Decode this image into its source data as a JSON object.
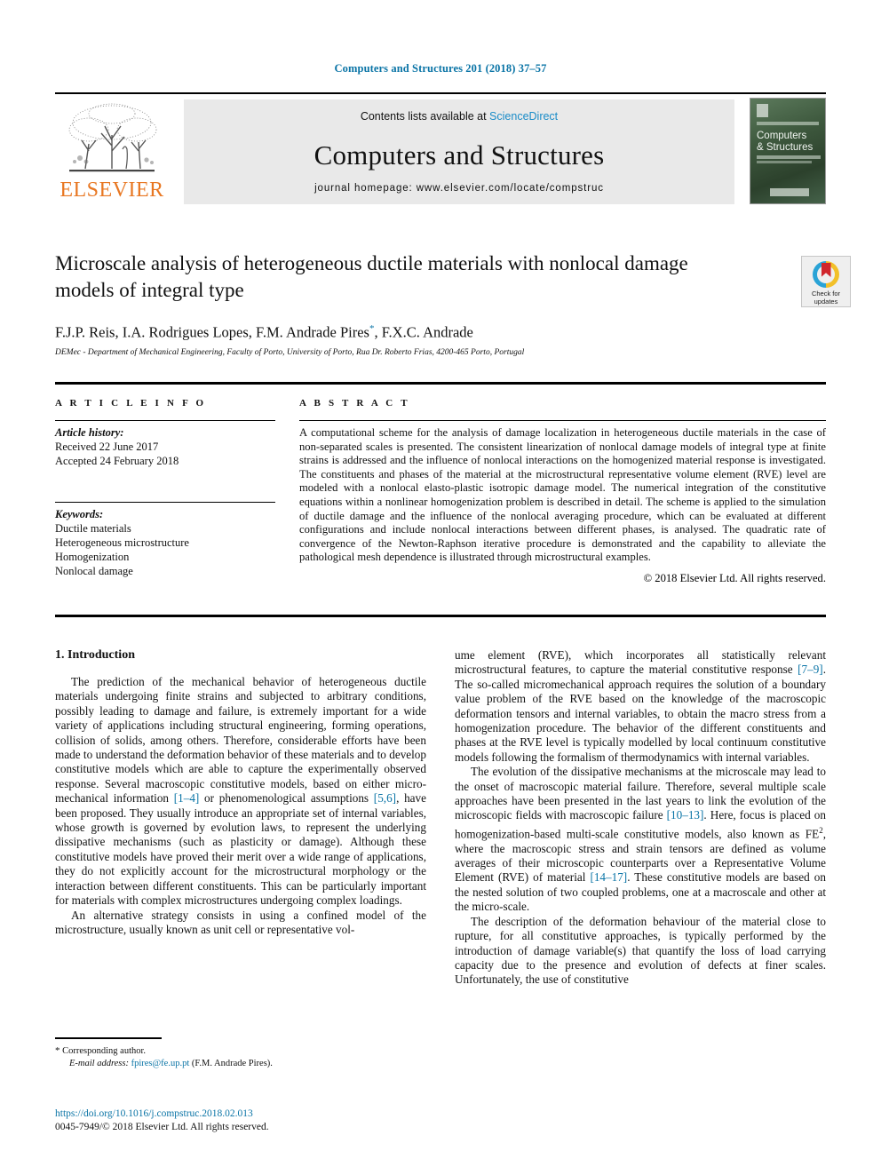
{
  "running_head": "Computers and Structures 201 (2018) 37–57",
  "masthead": {
    "contents_prefix": "Contents lists available at ",
    "sciencedirect": "ScienceDirect",
    "journal_name": "Computers and Structures",
    "homepage": "journal homepage: www.elsevier.com/locate/compstruc",
    "publisher_logo_text": "ELSEVIER",
    "publisher_logo_icon": "elsevier-tree-icon",
    "cover": {
      "line1": "Computers",
      "line2": "& Structures",
      "alt": "journal-cover-thumbnail"
    }
  },
  "article": {
    "title": "Microscale analysis of heterogeneous ductile materials with nonlocal damage models of integral type",
    "authors": "F.J.P. Reis, I.A. Rodrigues Lopes, F.M. Andrade Pires",
    "corresponding_marker": "*",
    "authors_tail": ", F.X.C. Andrade",
    "affiliation": "DEMec - Department of Mechanical Engineering, Faculty of Porto, University of Porto, Rua Dr. Roberto Frias, 4200-465 Porto, Portugal",
    "crossmark": {
      "line1": "Check for",
      "line2": "updates",
      "icon": "crossmark-badge-icon"
    }
  },
  "article_info": {
    "heading": "A R T I C L E   I N F O",
    "history_label": "Article history:",
    "history": [
      "Received 22 June 2017",
      "Accepted 24 February 2018"
    ],
    "keywords_label": "Keywords:",
    "keywords": [
      "Ductile materials",
      "Heterogeneous microstructure",
      "Homogenization",
      "Nonlocal damage"
    ]
  },
  "abstract": {
    "heading": "A B S T R A C T",
    "text": "A computational scheme for the analysis of damage localization in heterogeneous ductile materials in the case of non-separated scales is presented. The consistent linearization of nonlocal damage models of integral type at finite strains is addressed and the influence of nonlocal interactions on the homogenized material response is investigated. The constituents and phases of the material at the microstructural representative volume element (RVE) level are modeled with a nonlocal elasto-plastic isotropic damage model. The numerical integration of the constitutive equations within a nonlinear homogenization problem is described in detail. The scheme is applied to the simulation of ductile damage and the influence of the nonlocal averaging procedure, which can be evaluated at different configurations and include nonlocal interactions between different phases, is analysed. The quadratic rate of convergence of the Newton-Raphson iterative procedure is demonstrated and the capability to alleviate the pathological mesh dependence is illustrated through microstructural examples.",
    "copyright": "© 2018 Elsevier Ltd. All rights reserved."
  },
  "body": {
    "section_heading": "1. Introduction",
    "left_paragraph_1_a": "The prediction of the mechanical behavior of heterogeneous ductile materials undergoing finite strains and subjected to arbitrary conditions, possibly leading to damage and failure, is extremely important for a wide variety of applications including structural engineering, forming operations, collision of solids, among others. Therefore, considerable efforts have been made to understand the deformation behavior of these materials and to develop constitutive models which are able to capture the experimentally observed response. Several macroscopic constitutive models, based on either micro-mechanical information ",
    "ref_1_4": "[1–4]",
    "left_paragraph_1_b": " or phenomenological assumptions ",
    "ref_5_6": "[5,6]",
    "left_paragraph_1_c": ", have been proposed. They usually introduce an appropriate set of internal variables, whose growth is governed by evolution laws, to represent the underlying dissipative mechanisms (such as plasticity or damage). Although these constitutive models have proved their merit over a wide range of applications, they do not explicitly account for the microstructural morphology or the interaction between different constituents. This can be particularly important for materials with complex microstructures undergoing complex loadings.",
    "left_paragraph_2": "An alternative strategy consists in using a confined model of the microstructure, usually known as unit cell or representative vol-",
    "right_paragraph_1_a": "ume element (RVE), which incorporates all statistically relevant microstructural features, to capture the material constitutive response ",
    "ref_7_9": "[7–9]",
    "right_paragraph_1_b": ". The so-called micromechanical approach requires the solution of a boundary value problem of the RVE based on the knowledge of the macroscopic deformation tensors and internal variables, to obtain the macro stress from a homogenization procedure. The behavior of the different constituents and phases at the RVE level is typically modelled by local continuum constitutive models following the formalism of thermodynamics with internal variables.",
    "right_paragraph_2_a": "The evolution of the dissipative mechanisms at the microscale may lead to the onset of macroscopic material failure. Therefore, several multiple scale approaches have been presented in the last years to link the evolution of the microscopic fields with macroscopic failure ",
    "ref_10_13": "[10–13]",
    "right_paragraph_2_b": ". Here, focus is placed on homogenization-based multi-scale constitutive models, also known as FE",
    "fe_superscript": "2",
    "right_paragraph_2_c": ", where the macroscopic stress and strain tensors are defined as volume averages of their microscopic counterparts over a Representative Volume Element (RVE) of material ",
    "ref_14_17": "[14–17]",
    "right_paragraph_2_d": ". These constitutive models are based on the nested solution of two coupled problems, one at a macroscale and other at the micro-scale.",
    "right_paragraph_3": "The description of the deformation behaviour of the material close to rupture, for all constitutive approaches, is typically performed by the introduction of damage variable(s) that quantify the loss of load carrying capacity due to the presence and evolution of defects at finer scales. Unfortunately, the use of constitutive"
  },
  "footnotes": {
    "corresponding_star": "*",
    "corresponding_text": "Corresponding author.",
    "email_label": "E-mail address:",
    "email": "fpires@fe.up.pt",
    "email_owner": "(F.M. Andrade Pires)."
  },
  "footer": {
    "doi": "https://doi.org/10.1016/j.compstruc.2018.02.013",
    "issn_line": "0045-7949/© 2018 Elsevier Ltd. All rights reserved."
  },
  "colors": {
    "link": "#0a74a6",
    "elsevier_orange": "#E87722",
    "band_gray": "#e9e9e9"
  }
}
